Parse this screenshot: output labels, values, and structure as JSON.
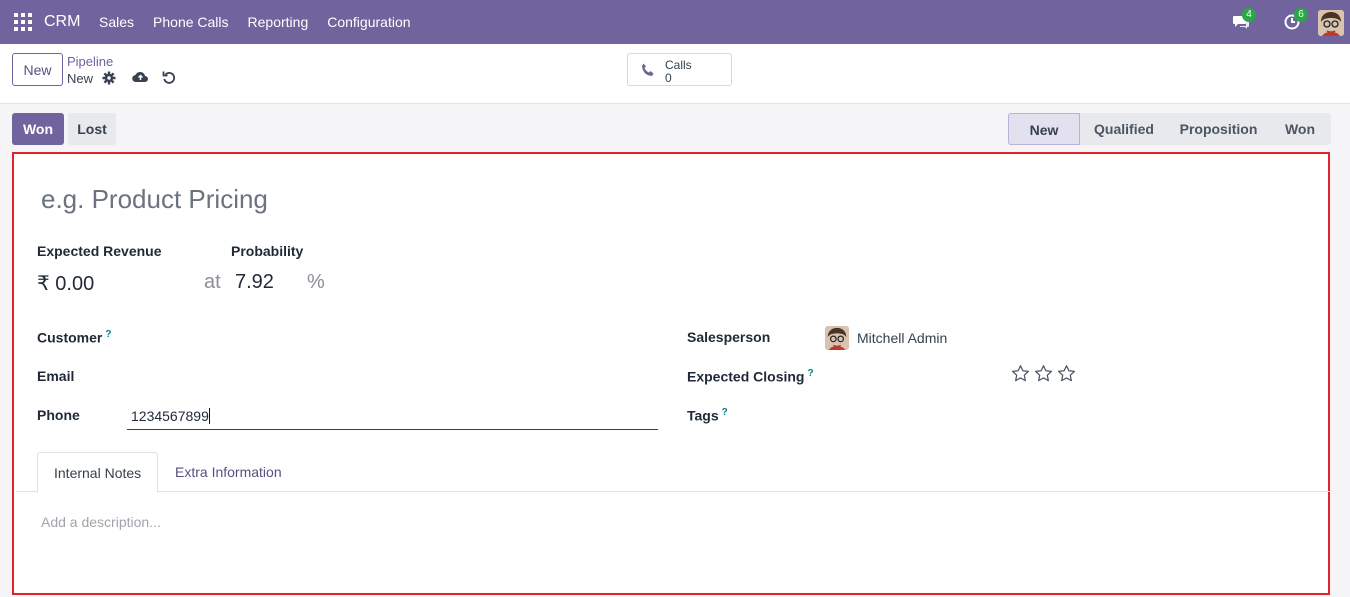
{
  "navbar": {
    "brand": "CRM",
    "menu": [
      "Sales",
      "Phone Calls",
      "Reporting",
      "Configuration"
    ],
    "chat_badge": "4",
    "activity_badge": "6"
  },
  "control": {
    "new_button": "New",
    "breadcrumb_parent": "Pipeline",
    "breadcrumb_current": "New",
    "calls_label": "Calls",
    "calls_count": "0"
  },
  "statusbar": {
    "won_button": "Won",
    "lost_button": "Lost",
    "stages": [
      "New",
      "Qualified",
      "Proposition",
      "Won"
    ],
    "active_stage": "New"
  },
  "form": {
    "title_placeholder": "e.g. Product Pricing",
    "expected_revenue_label": "Expected Revenue",
    "probability_label": "Probability",
    "revenue_value": "₹ 0.00",
    "at_text": "at",
    "probability_value": "7.92",
    "percent_sign": "%",
    "customer_label": "Customer",
    "email_label": "Email",
    "phone_label": "Phone",
    "phone_value": "1234567899",
    "salesperson_label": "Salesperson",
    "salesperson_value": "Mitchell Admin",
    "expected_closing_label": "Expected Closing",
    "tags_label": "Tags",
    "help_mark": "?",
    "priority_stars": 3
  },
  "tabs": [
    "Internal Notes",
    "Extra Information"
  ],
  "notes": {
    "placeholder": "Add a description..."
  },
  "colors": {
    "navbar": "#71639e",
    "highlight_border": "#e0242f",
    "badge": "#28a745"
  }
}
